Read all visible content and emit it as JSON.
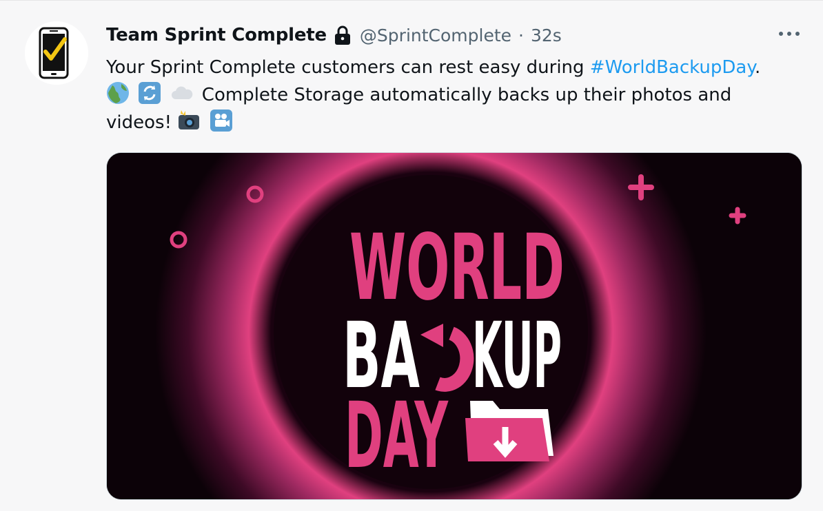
{
  "tweet": {
    "display_name": "Team Sprint Complete",
    "handle": "@SprintComplete",
    "separator": "·",
    "timestamp": "32s",
    "text_line1_before": "Your Sprint Complete customers can rest easy during ",
    "hashtag": "#WorldBackupDay",
    "text_line1_after": ".",
    "text_line2": " Complete Storage automatically backs up their photos and videos! ",
    "colors": {
      "hashtag": "#1d9bf0",
      "secondary_text": "#536471",
      "image_accent": "#e0407f"
    },
    "icons": {
      "lock": "lock-icon",
      "more": "more-icon",
      "emoji": [
        "globe-icon",
        "refresh-icon",
        "cloud-icon",
        "camera-flash-icon",
        "movie-camera-icon"
      ]
    }
  },
  "media": {
    "line1": "WORLD",
    "line2_part1": "BA",
    "line2_part2": "KUP",
    "line3": "DAY"
  }
}
